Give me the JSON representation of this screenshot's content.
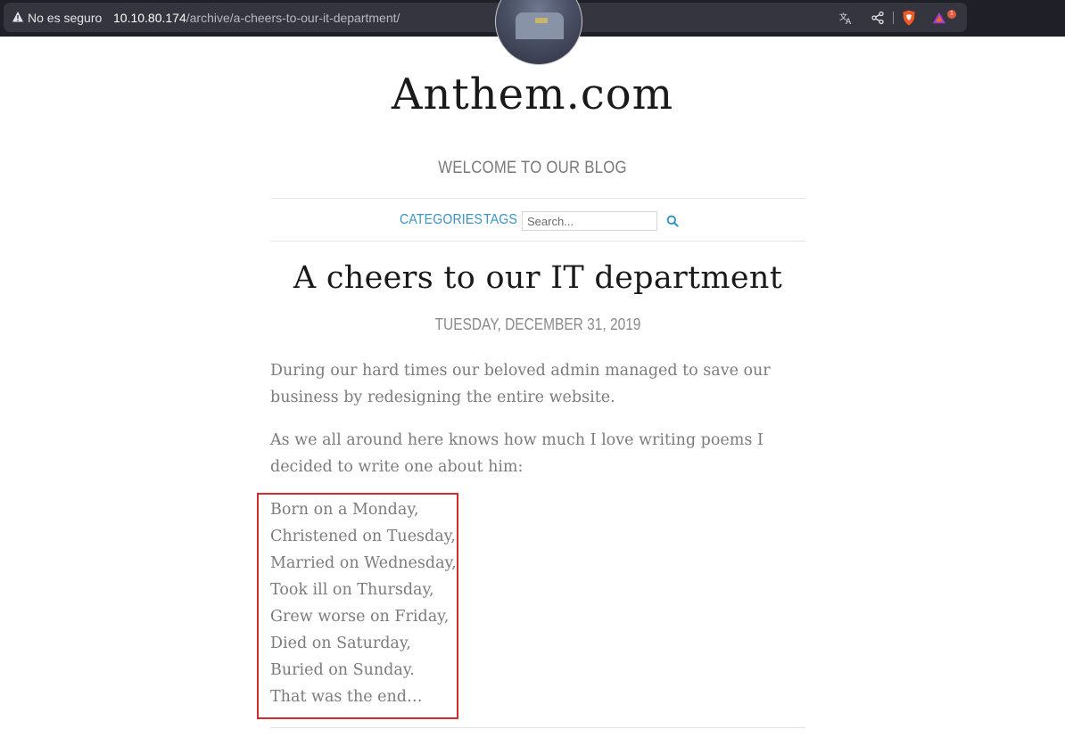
{
  "browser": {
    "security_label": "No es seguro",
    "url_host": "10.10.80.174",
    "url_path": "/archive/a-cheers-to-our-it-department/",
    "notification_count": "1",
    "icons": [
      "warning-icon",
      "translate-icon",
      "share-icon",
      "brave-shield-icon",
      "brave-rewards-icon"
    ]
  },
  "site": {
    "title": "Anthem.com",
    "tagline": "WELCOME TO OUR BLOG"
  },
  "nav": {
    "categories_label": "CATEGORIES",
    "tags_label": "TAGS",
    "search_placeholder": "Search...",
    "search_value": ""
  },
  "post": {
    "title": "A cheers to our IT department",
    "date": "TUESDAY, DECEMBER 31, 2019",
    "paragraph_1": "During our hard times our beloved admin managed to save our business by redesigning the entire website.",
    "paragraph_2": "As we all around here knows how much I love writing poems I decided to write one about him:",
    "poem_lines": [
      "Born on a Monday,",
      "Christened on Tuesday,",
      "Married on Wednesday,",
      "Took ill on Thursday,",
      "Grew worse on Friday,",
      "Died on Saturday,",
      "Buried on Sunday.",
      "That was the end…"
    ]
  },
  "colors": {
    "link": "#3a94c4",
    "highlight_box": "#d62b2b",
    "body_text": "#7c7c7c",
    "chrome_bg": "#1f1f27"
  }
}
